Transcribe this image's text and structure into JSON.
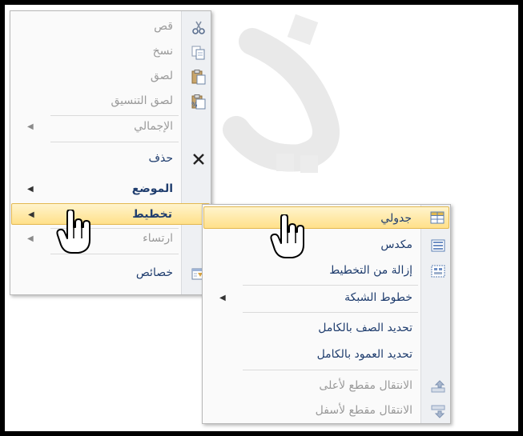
{
  "main_menu": {
    "items": [
      {
        "label": "قص",
        "icon": "scissors-icon",
        "enabled": false
      },
      {
        "label": "نسخ",
        "icon": "copy-icon",
        "enabled": false
      },
      {
        "label": "لصق",
        "icon": "paste-icon",
        "enabled": false
      },
      {
        "label": "لصق التنسيق",
        "icon": "paste-format-icon",
        "enabled": false
      },
      {
        "label": "الإجمالي",
        "enabled": false,
        "submenu": true
      },
      {
        "label": "حذف",
        "icon": "delete-x-icon",
        "enabled": true
      },
      {
        "label": "الموضع",
        "enabled": true,
        "submenu": true
      },
      {
        "label": "تخطيط",
        "enabled": true,
        "submenu": true,
        "highlighted": true
      },
      {
        "label": "ارتساء",
        "enabled": false,
        "submenu": true
      },
      {
        "label": "خصائص",
        "icon": "properties-icon",
        "enabled": true
      }
    ]
  },
  "layout_submenu": {
    "items": [
      {
        "label": "جدولي",
        "icon": "tabular-layout-icon",
        "enabled": true,
        "highlighted": true
      },
      {
        "label": "مكدس",
        "icon": "stacked-layout-icon",
        "enabled": true
      },
      {
        "label": "إزالة من التخطيط",
        "icon": "remove-layout-icon",
        "enabled": true
      },
      {
        "label": "خطوط الشبكة",
        "enabled": true,
        "submenu": true
      },
      {
        "label": "تحديد الصف بالكامل",
        "enabled": true
      },
      {
        "label": "تحديد العمود بالكامل",
        "enabled": true
      },
      {
        "label": "الانتقال مقطع لأعلى",
        "icon": "move-up-icon",
        "enabled": false
      },
      {
        "label": "الانتقال مقطع لأسفل",
        "icon": "move-down-icon",
        "enabled": false
      }
    ]
  },
  "colors": {
    "highlight_top": "#fff4cc",
    "highlight_bottom": "#ffe08a",
    "text": "#1f3d6e",
    "disabled": "#9a9a9a"
  }
}
